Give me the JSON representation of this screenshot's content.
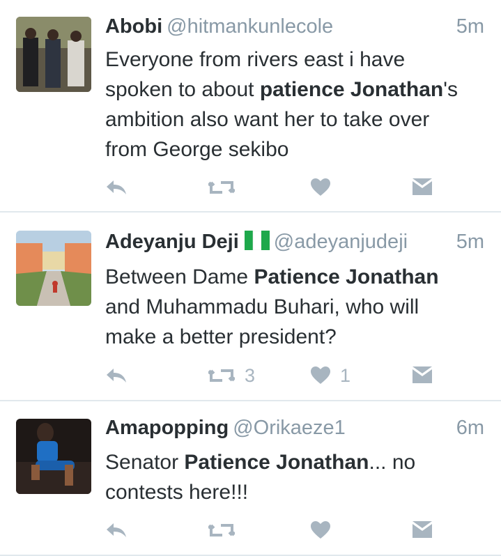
{
  "tweets": [
    {
      "name": "Abobi",
      "handle": "@hitmankunlecole",
      "time": "5m",
      "text_lines": [
        [
          "Everyone from rivers east i have",
          "",
          ""
        ],
        [
          "spoken to about ",
          "patience Jonathan",
          "'s"
        ],
        [
          "ambition also want her to take over",
          "",
          ""
        ],
        [
          "from George sekibo",
          "",
          ""
        ]
      ],
      "retweets": "",
      "likes": ""
    },
    {
      "name": "Adeyanju Deji",
      "handle": "@adeyanjudeji",
      "time": "5m",
      "text_lines": [
        [
          "Between Dame ",
          "Patience Jonathan",
          ""
        ],
        [
          "and Muhammadu Buhari, who will",
          "",
          ""
        ],
        [
          "make a better president?",
          "",
          ""
        ]
      ],
      "retweets": "3",
      "likes": "1"
    },
    {
      "name": "Amapopping",
      "handle": "@Orikaeze1",
      "time": "6m",
      "text_lines": [
        [
          "Senator ",
          "Patience Jonathan",
          "... no"
        ],
        [
          "contests here!!!",
          "",
          ""
        ]
      ],
      "retweets": "",
      "likes": ""
    }
  ],
  "icons": [
    "reply-icon",
    "retweet-icon",
    "heart-icon",
    "dm-icon",
    "nigeria-flag-icon"
  ],
  "colors": {
    "name": "#292f33",
    "muted": "#8899a6",
    "action": "#a8b5c0",
    "divider": "#e1e8ed"
  }
}
